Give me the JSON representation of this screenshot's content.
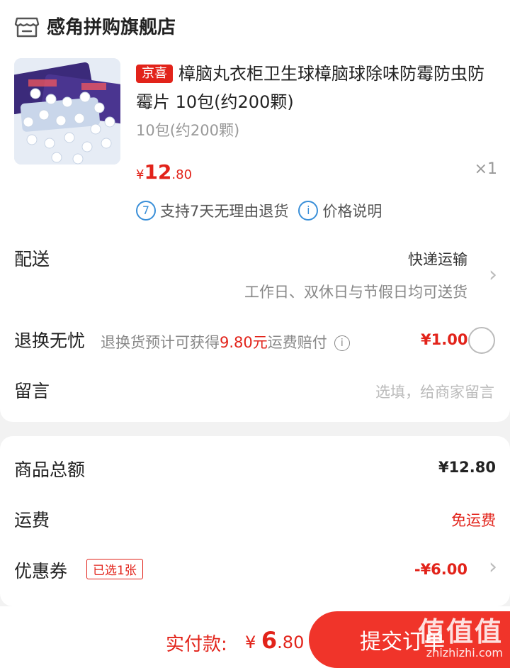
{
  "shop": {
    "name": "感角拼购旗舰店",
    "icon": "store-icon"
  },
  "product": {
    "tag": "京喜",
    "title": "樟脑丸衣柜卫生球樟脑球除味防霉防虫防霉片 10包(约200颗)",
    "spec": "10包(约200颗)",
    "price_symbol": "¥",
    "price_int": "12",
    "price_dec": ".80",
    "quantity": "×1",
    "services": [
      {
        "badge": "7",
        "text": "支持7天无理由退货"
      },
      {
        "badge": "i",
        "text": "价格说明"
      }
    ]
  },
  "delivery": {
    "label": "配送",
    "method": "快递运输",
    "note": "工作日、双休日与节假日均可送货"
  },
  "return_worry": {
    "label": "退换无忧",
    "desc_prefix": "退换货预计可获得",
    "desc_amount": "9.80元",
    "desc_suffix": "运费赔付",
    "price": "¥1.00"
  },
  "message": {
    "label": "留言",
    "placeholder": "选填，给商家留言"
  },
  "summary": {
    "goods_total_label": "商品总额",
    "goods_total": "¥12.80",
    "shipping_label": "运费",
    "shipping_value": "免运费",
    "coupon_label": "优惠券",
    "coupon_tag": "已选1张",
    "coupon_value": "-¥6.00"
  },
  "checkout": {
    "pay_label": "实付款:",
    "pay_symbol": "¥ ",
    "pay_int": "6",
    "pay_dec": ".80",
    "submit_label": "提交订单"
  },
  "watermark": {
    "logo": "值值值",
    "url": "zhizhizhi.com"
  },
  "colors": {
    "accent": "#e2231a",
    "button": "#f0342a",
    "info_blue": "#3a8fd8"
  }
}
